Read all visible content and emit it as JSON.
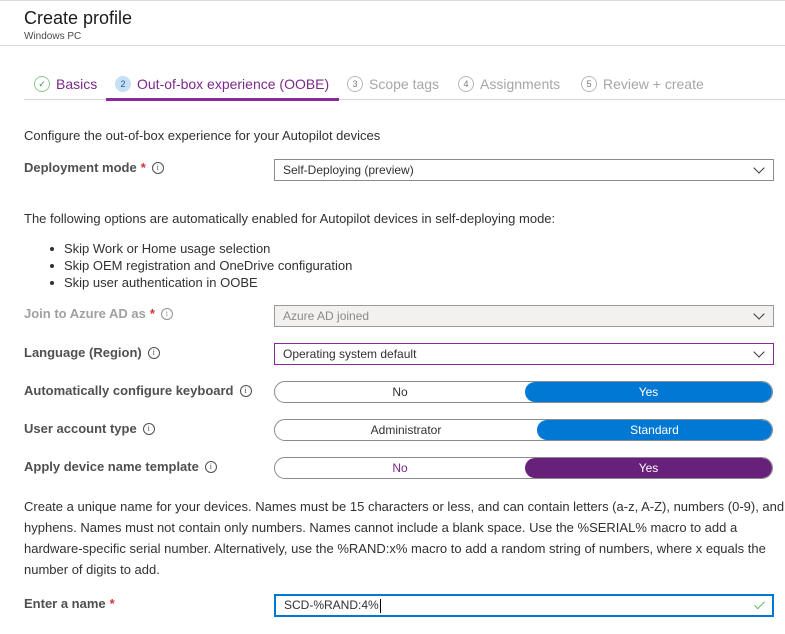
{
  "header": {
    "title": "Create profile",
    "subtitle": "Windows PC"
  },
  "tabs": [
    {
      "number": "✓",
      "label": "Basics",
      "state": "done"
    },
    {
      "number": "2",
      "label": "Out-of-box experience (OOBE)",
      "state": "active"
    },
    {
      "number": "3",
      "label": "Scope tags",
      "state": "inactive"
    },
    {
      "number": "4",
      "label": "Assignments",
      "state": "inactive"
    },
    {
      "number": "5",
      "label": "Review + create",
      "state": "inactive"
    }
  ],
  "intro": "Configure the out-of-box experience for your Autopilot devices",
  "deployment_mode": {
    "label": "Deployment mode",
    "required": "*",
    "value": "Self-Deploying (preview)"
  },
  "auto_enabled": {
    "text": "The following options are automatically enabled for Autopilot devices in self-deploying mode:",
    "items": [
      "Skip Work or Home usage selection",
      "Skip OEM registration and OneDrive configuration",
      "Skip user authentication in OOBE"
    ]
  },
  "join_azure": {
    "label": "Join to Azure AD as",
    "required": "*",
    "value": "Azure AD joined"
  },
  "language": {
    "label": "Language (Region)",
    "value": "Operating system default"
  },
  "keyboard": {
    "label": "Automatically configure keyboard",
    "options": [
      "No",
      "Yes"
    ],
    "selected": "Yes"
  },
  "account_type": {
    "label": "User account type",
    "options": [
      "Administrator",
      "Standard"
    ],
    "selected": "Standard"
  },
  "name_template": {
    "label": "Apply device name template",
    "options": [
      "No",
      "Yes"
    ],
    "selected": "Yes"
  },
  "name_help": {
    "lines": [
      "Create a unique name for your devices. Names must be 15 characters or less, and can contain letters (a-z, A-Z), numbers (0-9), and",
      "hyphens. Names must not contain only numbers. Names cannot include a blank space. Use the %SERIAL% macro to add a",
      "hardware-specific serial number. Alternatively, use the %RAND:x% macro to add a random string of numbers, where x equals the",
      "number of digits to add."
    ]
  },
  "enter_name": {
    "label": "Enter a name",
    "required": "*",
    "value": "SCD-%RAND:4%"
  },
  "info_icon_glyph": "i",
  "colors": {
    "accent_purple": "#68217a",
    "toggle_blue": "#0078d4",
    "required_red": "#d13438",
    "valid_green": "#5cb85c"
  }
}
